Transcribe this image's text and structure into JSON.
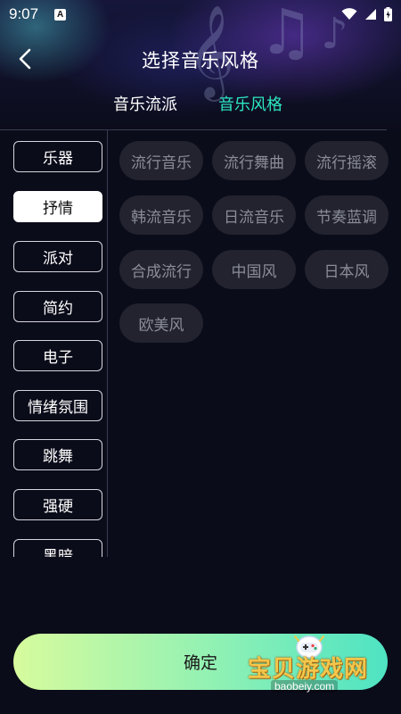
{
  "status_bar": {
    "time": "9:07",
    "notification_icon": "a-icon",
    "icons": [
      "wifi-icon",
      "signal-icon",
      "battery-charging-icon"
    ]
  },
  "header": {
    "title": "选择音乐风格",
    "back_icon": "chevron-left-icon"
  },
  "tabs": {
    "genre_label": "音乐流派",
    "style_label": "音乐风格",
    "active": "style_label",
    "active_color": "#2ee6c4"
  },
  "sidebar": {
    "items": [
      {
        "label": "乐器"
      },
      {
        "label": "抒情"
      },
      {
        "label": "派对"
      },
      {
        "label": "简约"
      },
      {
        "label": "电子"
      },
      {
        "label": "情绪氛围"
      },
      {
        "label": "跳舞"
      },
      {
        "label": "强硬"
      },
      {
        "label": "黑暗"
      }
    ],
    "active_index": 1
  },
  "styles": [
    {
      "label": "流行音乐"
    },
    {
      "label": "流行舞曲"
    },
    {
      "label": "流行摇滚"
    },
    {
      "label": "韩流音乐"
    },
    {
      "label": "日流音乐"
    },
    {
      "label": "节奏蓝调"
    },
    {
      "label": "合成流行"
    },
    {
      "label": "中国风"
    },
    {
      "label": "日本风"
    },
    {
      "label": "欧美风"
    }
  ],
  "confirm_button": {
    "label": "确定",
    "gradient": [
      "#d7fb9d",
      "#4ee3c3"
    ]
  },
  "watermark": {
    "text": "宝贝游戏网",
    "url": "baobeiy.com"
  }
}
